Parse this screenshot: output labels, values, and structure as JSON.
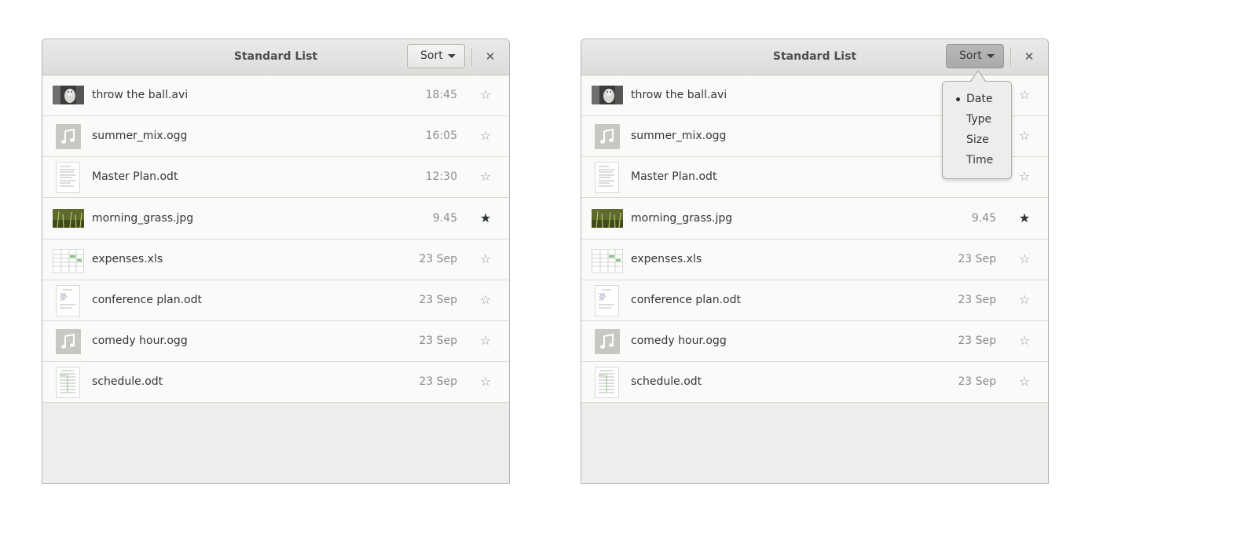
{
  "windows": [
    {
      "title": "Standard List",
      "sort_label": "Sort",
      "close_label": "✕",
      "items": [
        {
          "name": "throw the ball.avi",
          "date": "18:45",
          "star": "☆",
          "kind": "video"
        },
        {
          "name": "summer_mix.ogg",
          "date": "16:05",
          "star": "☆",
          "kind": "music"
        },
        {
          "name": "Master Plan.odt",
          "date": "12:30",
          "star": "☆",
          "kind": "doc"
        },
        {
          "name": "morning_grass.jpg",
          "date": "9.45",
          "star": "★",
          "kind": "photo"
        },
        {
          "name": "expenses.xls",
          "date": "23 Sep",
          "star": "☆",
          "kind": "sheet"
        },
        {
          "name": "conference plan.odt",
          "date": "23 Sep",
          "star": "☆",
          "kind": "doc"
        },
        {
          "name": "comedy hour.ogg",
          "date": "23 Sep",
          "star": "☆",
          "kind": "music"
        },
        {
          "name": "schedule.odt",
          "date": "23 Sep",
          "star": "☆",
          "kind": "doc"
        }
      ]
    },
    {
      "title": "Standard List",
      "sort_label": "Sort",
      "close_label": "✕",
      "items": [
        {
          "name": "throw the ball.avi",
          "date": "",
          "star": "☆",
          "kind": "video"
        },
        {
          "name": "summer_mix.ogg",
          "date": "",
          "star": "☆",
          "kind": "music"
        },
        {
          "name": "Master Plan.odt",
          "date": "",
          "star": "☆",
          "kind": "doc"
        },
        {
          "name": "morning_grass.jpg",
          "date": "9.45",
          "star": "★",
          "kind": "photo"
        },
        {
          "name": "expenses.xls",
          "date": "23 Sep",
          "star": "☆",
          "kind": "sheet"
        },
        {
          "name": "conference plan.odt",
          "date": "23 Sep",
          "star": "☆",
          "kind": "doc"
        },
        {
          "name": "comedy hour.ogg",
          "date": "23 Sep",
          "star": "☆",
          "kind": "music"
        },
        {
          "name": "schedule.odt",
          "date": "23 Sep",
          "star": "☆",
          "kind": "doc"
        }
      ]
    }
  ],
  "sort_menu": {
    "options": [
      "Date",
      "Type",
      "Size",
      "Time"
    ],
    "selected": "Date"
  },
  "icons": {
    "music": "music-note-icon",
    "star_empty": "star-outline-icon",
    "star_filled": "star-filled-icon",
    "close": "close-icon",
    "dropdown": "chevron-down-icon"
  }
}
